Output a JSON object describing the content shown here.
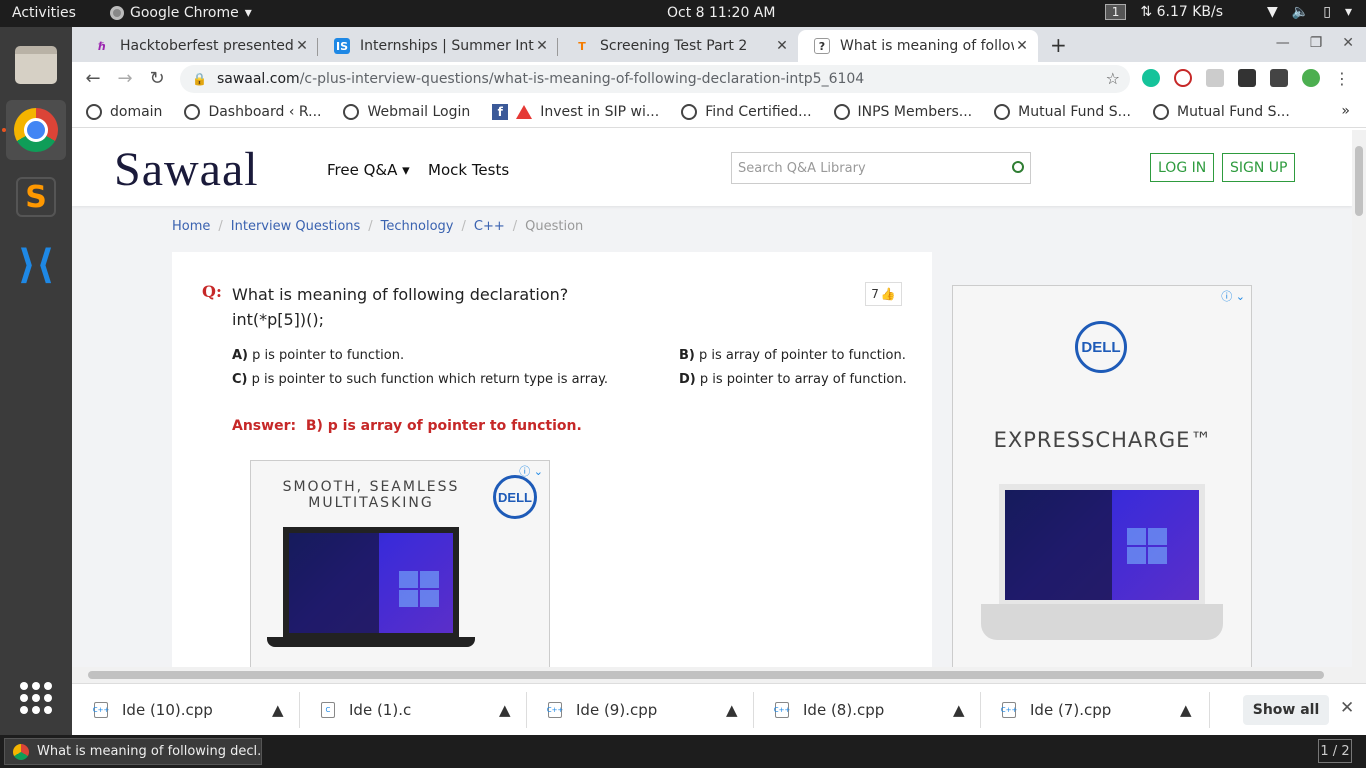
{
  "system": {
    "activities": "Activities",
    "app_name": "Google Chrome",
    "clock": "Oct 8  11:20 AM",
    "workspace": "1",
    "net_speed": "⇅ 6.17 KB/s"
  },
  "tabs": [
    {
      "title": "Hacktoberfest presented",
      "fav": "ℏ",
      "fav_color": "#9c27b0"
    },
    {
      "title": "Internships | Summer Inte",
      "fav": "IS",
      "fav_color": "#1e88e5"
    },
    {
      "title": "Screening Test Part 2",
      "fav": "T",
      "fav_color": "#f57c00"
    },
    {
      "title": "What is meaning of follow",
      "fav": "?",
      "fav_color": "#333333",
      "active": true
    }
  ],
  "omnibox": {
    "host": "sawaal.com",
    "path": "/c-plus-interview-questions/what-is-meaning-of-following-declaration-intp5_6104"
  },
  "bookmarks": [
    {
      "label": "domain",
      "icon": "globe-icon"
    },
    {
      "label": "Dashboard ‹ R...",
      "icon": "globe-icon"
    },
    {
      "label": "Webmail Login",
      "icon": "globe-icon"
    },
    {
      "label": "Invest in SIP wi...",
      "icon": "facebook-icon"
    },
    {
      "label": "Find Certified...",
      "icon": "warning-icon"
    },
    {
      "label": "INPS Members...",
      "icon": "globe-icon"
    },
    {
      "label": "Mutual Fund S...",
      "icon": "globe-icon"
    },
    {
      "label": "Mutual Fund S...",
      "icon": "globe-icon"
    }
  ],
  "site": {
    "logo": "Sawaal",
    "menu_free": "Free Q&A ▾",
    "menu_mock": "Mock Tests",
    "search_placeholder": "Search Q&A Library",
    "login": "LOG IN",
    "signup": "SIGN UP"
  },
  "breadcrumb": [
    "Home",
    "Interview Questions",
    "Technology",
    "C++",
    "Question"
  ],
  "question": {
    "q_mark": "Q:",
    "line1": "What is meaning of following declaration?",
    "line2": "int(*p[5])();",
    "likes": "7",
    "options": [
      {
        "key": "A)",
        "text": "p is pointer to function."
      },
      {
        "key": "B)",
        "text": "p is array of pointer to function."
      },
      {
        "key": "C)",
        "text": "p is pointer to such function which return type is array."
      },
      {
        "key": "D)",
        "text": "p is pointer to array of function."
      }
    ],
    "answer_label": "Answer:",
    "answer_text": "B) p is array of pointer to function."
  },
  "ads": {
    "small_tagline": "SMOOTH, SEAMLESS MULTITASKING",
    "brand": "DELL",
    "big_tagline": "EXPRESSCHARGE™"
  },
  "downloads": [
    {
      "name": "Ide (10).cpp",
      "type": "C++"
    },
    {
      "name": "Ide (1).c",
      "type": "C"
    },
    {
      "name": "Ide (9).cpp",
      "type": "C++"
    },
    {
      "name": "Ide (8).cpp",
      "type": "C++"
    },
    {
      "name": "Ide (7).cpp",
      "type": "C++"
    }
  ],
  "show_all": "Show all",
  "taskbar": {
    "window_title": "What is meaning of following decl...",
    "pager": "1 / 2"
  }
}
